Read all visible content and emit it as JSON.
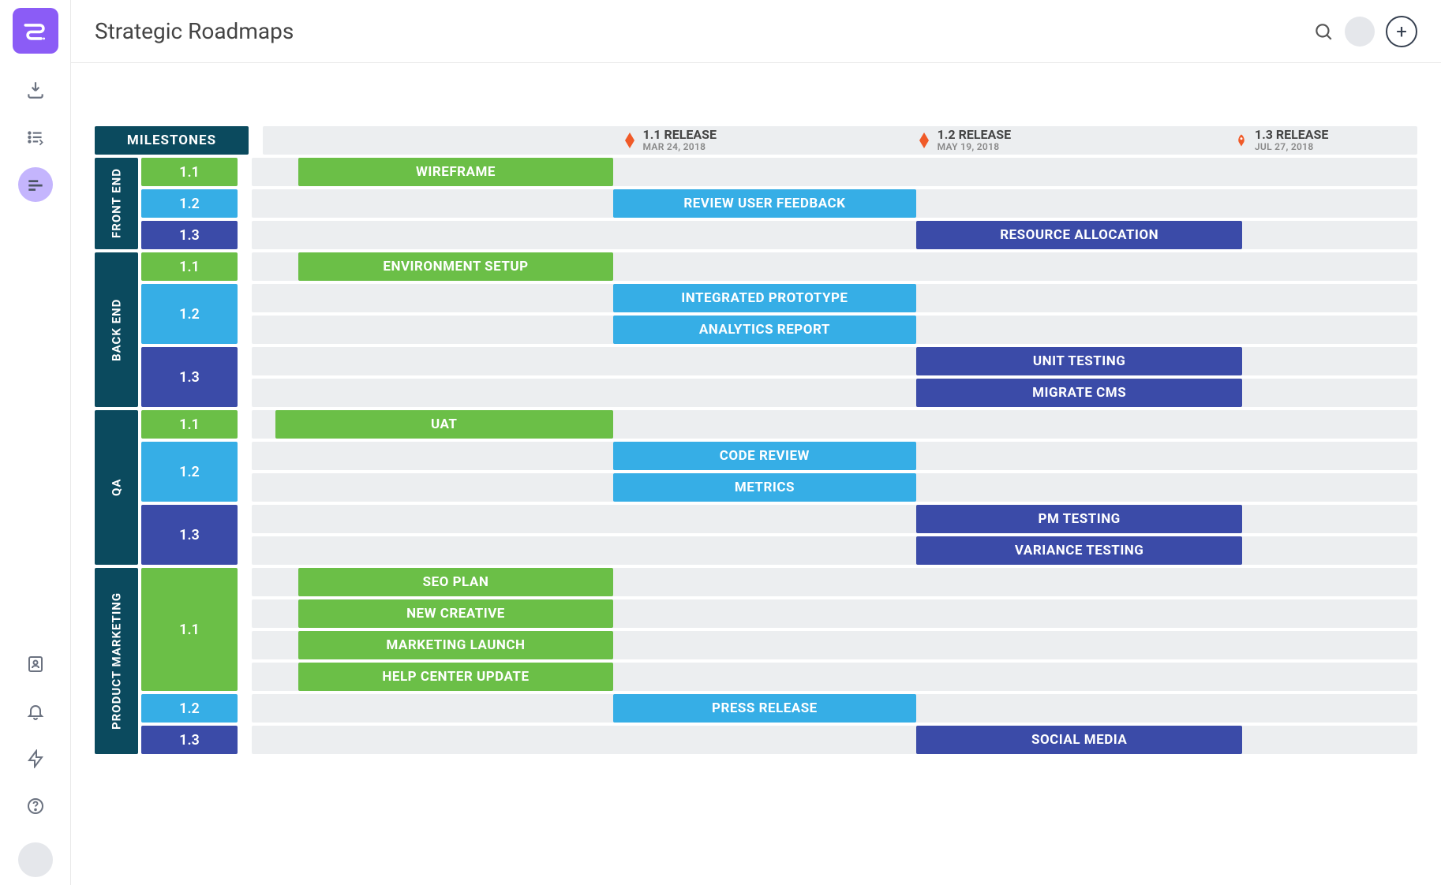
{
  "app_title": "Strategic Roadmaps",
  "milestones_label": "MILESTONES",
  "milestones": [
    {
      "title": "1.1 RELEASE",
      "date": "MAR 24, 2018",
      "pct": 31,
      "marker": "diamond"
    },
    {
      "title": "1.2 RELEASE",
      "date": "MAY 19, 2018",
      "pct": 56.5,
      "marker": "diamond"
    },
    {
      "title": "1.3 RELEASE",
      "date": "JUL 27, 2018",
      "pct": 84,
      "marker": "rocket"
    }
  ],
  "swimlanes": [
    {
      "name": "FRONT END",
      "groups": [
        {
          "version": "1.1",
          "color": "green",
          "tasks": [
            {
              "label": "WIREFRAME",
              "start": 4,
              "end": 31,
              "color": "green"
            }
          ]
        },
        {
          "version": "1.2",
          "color": "blue",
          "tasks": [
            {
              "label": "REVIEW USER FEEDBACK",
              "start": 31,
              "end": 57,
              "color": "blue"
            }
          ]
        },
        {
          "version": "1.3",
          "color": "navy",
          "tasks": [
            {
              "label": "RESOURCE ALLOCATION",
              "start": 57,
              "end": 85,
              "color": "navy"
            }
          ]
        }
      ]
    },
    {
      "name": "BACK END",
      "groups": [
        {
          "version": "1.1",
          "color": "green",
          "tasks": [
            {
              "label": "ENVIRONMENT SETUP",
              "start": 4,
              "end": 31,
              "color": "green"
            }
          ]
        },
        {
          "version": "1.2",
          "color": "blue",
          "tasks": [
            {
              "label": "INTEGRATED PROTOTYPE",
              "start": 31,
              "end": 57,
              "color": "blue"
            },
            {
              "label": "ANALYTICS REPORT",
              "start": 31,
              "end": 57,
              "color": "blue"
            }
          ]
        },
        {
          "version": "1.3",
          "color": "navy",
          "tasks": [
            {
              "label": "UNIT TESTING",
              "start": 57,
              "end": 85,
              "color": "navy"
            },
            {
              "label": "MIGRATE CMS",
              "start": 57,
              "end": 85,
              "color": "navy"
            }
          ]
        }
      ]
    },
    {
      "name": "QA",
      "groups": [
        {
          "version": "1.1",
          "color": "green",
          "tasks": [
            {
              "label": "UAT",
              "start": 2,
              "end": 31,
              "color": "green"
            }
          ]
        },
        {
          "version": "1.2",
          "color": "blue",
          "tasks": [
            {
              "label": "CODE REVIEW",
              "start": 31,
              "end": 57,
              "color": "blue"
            },
            {
              "label": "METRICS",
              "start": 31,
              "end": 57,
              "color": "blue"
            }
          ]
        },
        {
          "version": "1.3",
          "color": "navy",
          "tasks": [
            {
              "label": "PM TESTING",
              "start": 57,
              "end": 85,
              "color": "navy"
            },
            {
              "label": "VARIANCE TESTING",
              "start": 57,
              "end": 85,
              "color": "navy"
            }
          ]
        }
      ]
    },
    {
      "name": "PRODUCT MARKETING",
      "groups": [
        {
          "version": "1.1",
          "color": "green",
          "tasks": [
            {
              "label": "SEO PLAN",
              "start": 4,
              "end": 31,
              "color": "green"
            },
            {
              "label": "NEW CREATIVE",
              "start": 4,
              "end": 31,
              "color": "green"
            },
            {
              "label": "MARKETING LAUNCH",
              "start": 4,
              "end": 31,
              "color": "green"
            },
            {
              "label": "HELP CENTER UPDATE",
              "start": 4,
              "end": 31,
              "color": "green"
            }
          ]
        },
        {
          "version": "1.2",
          "color": "blue",
          "tasks": [
            {
              "label": "PRESS RELEASE",
              "start": 31,
              "end": 57,
              "color": "blue"
            }
          ]
        },
        {
          "version": "1.3",
          "color": "navy",
          "tasks": [
            {
              "label": "SOCIAL MEDIA",
              "start": 57,
              "end": 85,
              "color": "navy"
            }
          ]
        }
      ]
    }
  ],
  "chart_data": {
    "type": "gantt",
    "title": "Strategic Roadmaps",
    "milestones": [
      {
        "label": "1.1 RELEASE",
        "date": "2018-03-24"
      },
      {
        "label": "1.2 RELEASE",
        "date": "2018-05-19"
      },
      {
        "label": "1.3 RELEASE",
        "date": "2018-07-27"
      }
    ],
    "swimlanes": [
      {
        "name": "FRONT END",
        "tasks": [
          {
            "task": "WIREFRAME",
            "release": "1.1"
          },
          {
            "task": "REVIEW USER FEEDBACK",
            "release": "1.2"
          },
          {
            "task": "RESOURCE ALLOCATION",
            "release": "1.3"
          }
        ]
      },
      {
        "name": "BACK END",
        "tasks": [
          {
            "task": "ENVIRONMENT SETUP",
            "release": "1.1"
          },
          {
            "task": "INTEGRATED PROTOTYPE",
            "release": "1.2"
          },
          {
            "task": "ANALYTICS REPORT",
            "release": "1.2"
          },
          {
            "task": "UNIT TESTING",
            "release": "1.3"
          },
          {
            "task": "MIGRATE CMS",
            "release": "1.3"
          }
        ]
      },
      {
        "name": "QA",
        "tasks": [
          {
            "task": "UAT",
            "release": "1.1"
          },
          {
            "task": "CODE REVIEW",
            "release": "1.2"
          },
          {
            "task": "METRICS",
            "release": "1.2"
          },
          {
            "task": "PM TESTING",
            "release": "1.3"
          },
          {
            "task": "VARIANCE TESTING",
            "release": "1.3"
          }
        ]
      },
      {
        "name": "PRODUCT MARKETING",
        "tasks": [
          {
            "task": "SEO PLAN",
            "release": "1.1"
          },
          {
            "task": "NEW CREATIVE",
            "release": "1.1"
          },
          {
            "task": "MARKETING LAUNCH",
            "release": "1.1"
          },
          {
            "task": "HELP CENTER UPDATE",
            "release": "1.1"
          },
          {
            "task": "PRESS RELEASE",
            "release": "1.2"
          },
          {
            "task": "SOCIAL MEDIA",
            "release": "1.3"
          }
        ]
      }
    ]
  }
}
